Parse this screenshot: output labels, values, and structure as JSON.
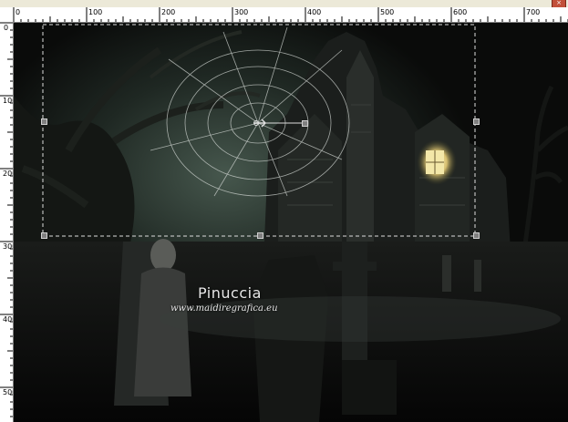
{
  "window": {
    "close_glyph": "×"
  },
  "rulers": {
    "horizontal_labels": [
      "0",
      "100",
      "200",
      "300",
      "400",
      "500",
      "600",
      "700"
    ],
    "vertical_labels": [
      "0",
      "100",
      "200",
      "300",
      "400",
      "500"
    ]
  },
  "image": {
    "description": "haunted-house-scene",
    "watermark_name": "Pinuccia",
    "watermark_url": "www.maidiregrafica.eu"
  },
  "icons": [
    "move-cursor-icon"
  ],
  "colors": {
    "ruler_bg": "#ffffff",
    "workspace_bg": "#d4d0c8",
    "selection": "#dcdcdc"
  }
}
